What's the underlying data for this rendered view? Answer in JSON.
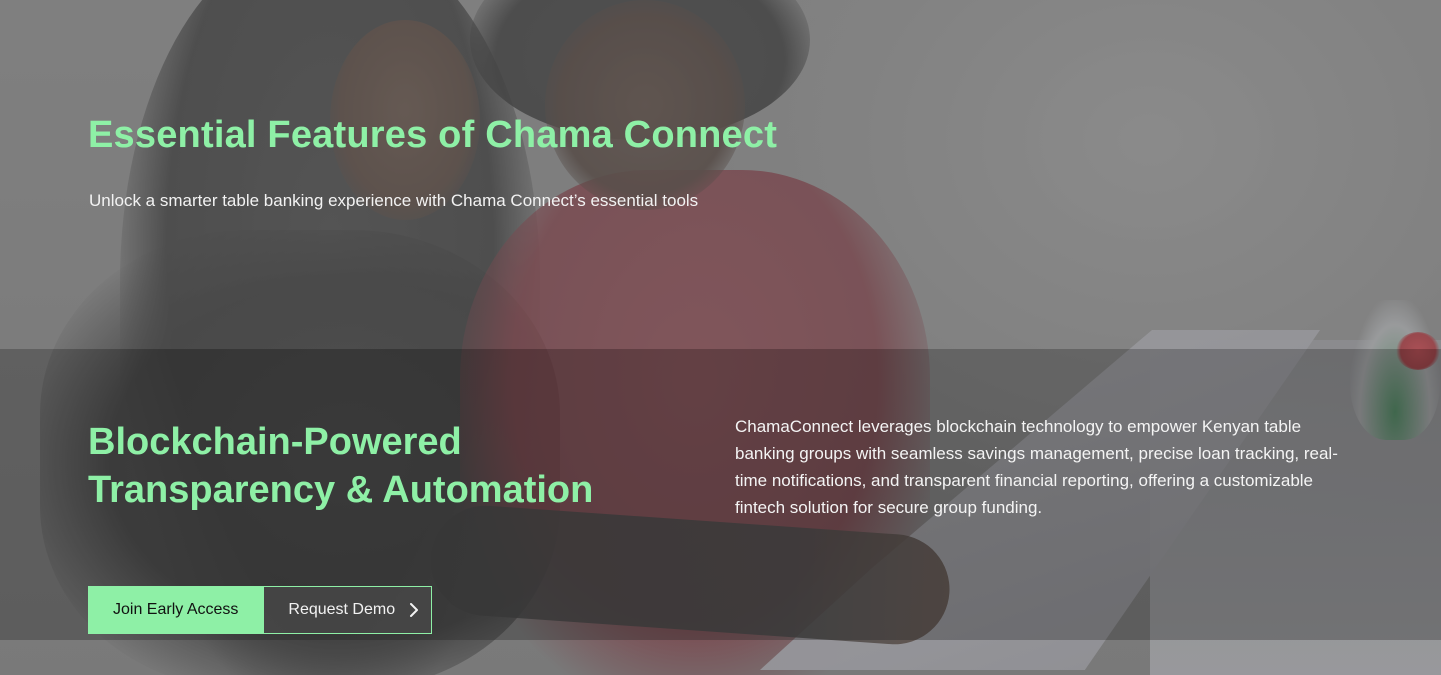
{
  "header": {
    "title": "Essential Features of Chama Connect",
    "subtitle": "Unlock a smarter table banking experience with Chama Connect’s essential tools"
  },
  "feature": {
    "title_line1": "Blockchain-Powered",
    "title_line2": "Transparency & Automation",
    "description": "ChamaConnect leverages blockchain technology to empower Kenyan table banking groups with seamless savings management, precise loan tracking, real-time notifications, and transparent financial reporting, offering a customizable fintech solution for secure group funding."
  },
  "cta": {
    "primary_label": "Join Early Access",
    "secondary_label": "Request Demo",
    "secondary_icon": "chevron-right-icon"
  },
  "colors": {
    "accent": "#8ef0a6",
    "text_light": "#f2f2f2"
  }
}
